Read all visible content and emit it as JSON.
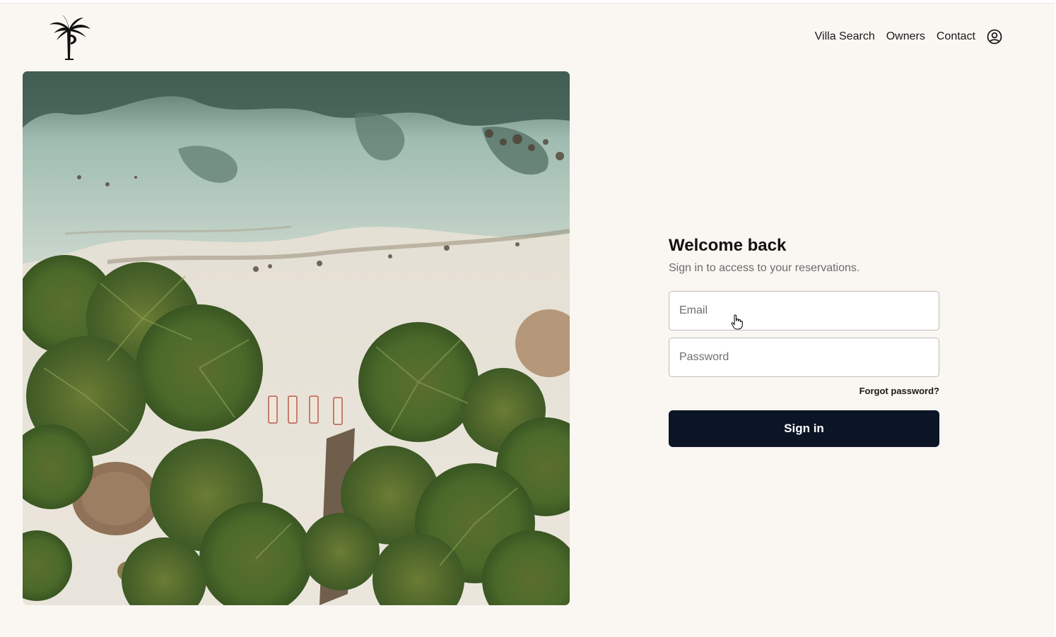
{
  "header": {
    "logo_icon": "palm-tree-logo-icon",
    "nav": [
      {
        "label": "Villa Search"
      },
      {
        "label": "Owners"
      },
      {
        "label": "Contact"
      }
    ],
    "account_icon": "user-circle-icon"
  },
  "hero": {
    "icon": "aerial-beach-photo"
  },
  "login": {
    "title": "Welcome back",
    "subtitle": "Sign in to access to your reservations.",
    "email_placeholder": "Email",
    "password_placeholder": "Password",
    "forgot_label": "Forgot password?",
    "submit_label": "Sign in"
  },
  "colors": {
    "page_background": "#faf7f2",
    "button_background": "#0b1526",
    "button_text": "#ffffff",
    "input_border": "#bcbcbc"
  }
}
